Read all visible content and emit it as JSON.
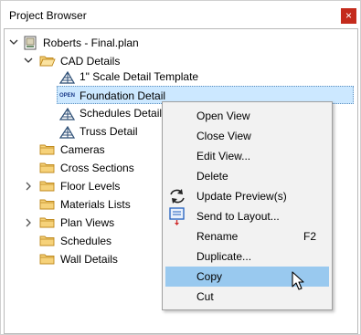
{
  "window": {
    "title": "Project Browser",
    "close_glyph": "×"
  },
  "tree": {
    "root": {
      "label": "Roberts - Final.plan",
      "icon": "plan-file-icon"
    },
    "cad_details": {
      "label": "CAD Details",
      "icon": "folder-open-icon"
    },
    "cad_children": [
      {
        "label": "1\" Scale Detail Template",
        "icon": "cad-detail-icon"
      },
      {
        "label": "Foundation Detail",
        "icon": "open-view-icon",
        "badge": "OPEN",
        "selected": true
      },
      {
        "label": "Schedules Detail",
        "icon": "cad-detail-icon"
      },
      {
        "label": "Truss Detail",
        "icon": "cad-detail-icon"
      }
    ],
    "folders": [
      {
        "label": "Cameras",
        "expandable": false
      },
      {
        "label": "Cross Sections",
        "expandable": false
      },
      {
        "label": "Floor Levels",
        "expandable": true
      },
      {
        "label": "Materials Lists",
        "expandable": false
      },
      {
        "label": "Plan Views",
        "expandable": true
      },
      {
        "label": "Schedules",
        "expandable": false
      },
      {
        "label": "Wall Details",
        "expandable": false
      }
    ]
  },
  "context_menu": {
    "items": [
      {
        "label": "Open View"
      },
      {
        "label": "Close View"
      },
      {
        "label": "Edit View..."
      },
      {
        "label": "Delete"
      },
      {
        "label": "Update Preview(s)",
        "icon": "refresh-icon"
      },
      {
        "label": "Send to Layout...",
        "icon": "send-to-layout-icon"
      },
      {
        "label": "Rename",
        "shortcut": "F2"
      },
      {
        "label": "Duplicate..."
      },
      {
        "label": "Copy",
        "highlighted": true
      },
      {
        "label": "Cut"
      }
    ]
  },
  "colors": {
    "selection": "#cce8ff",
    "menu_highlight": "#99c9ef",
    "folder": "#e8b040",
    "close": "#c42b1c"
  }
}
